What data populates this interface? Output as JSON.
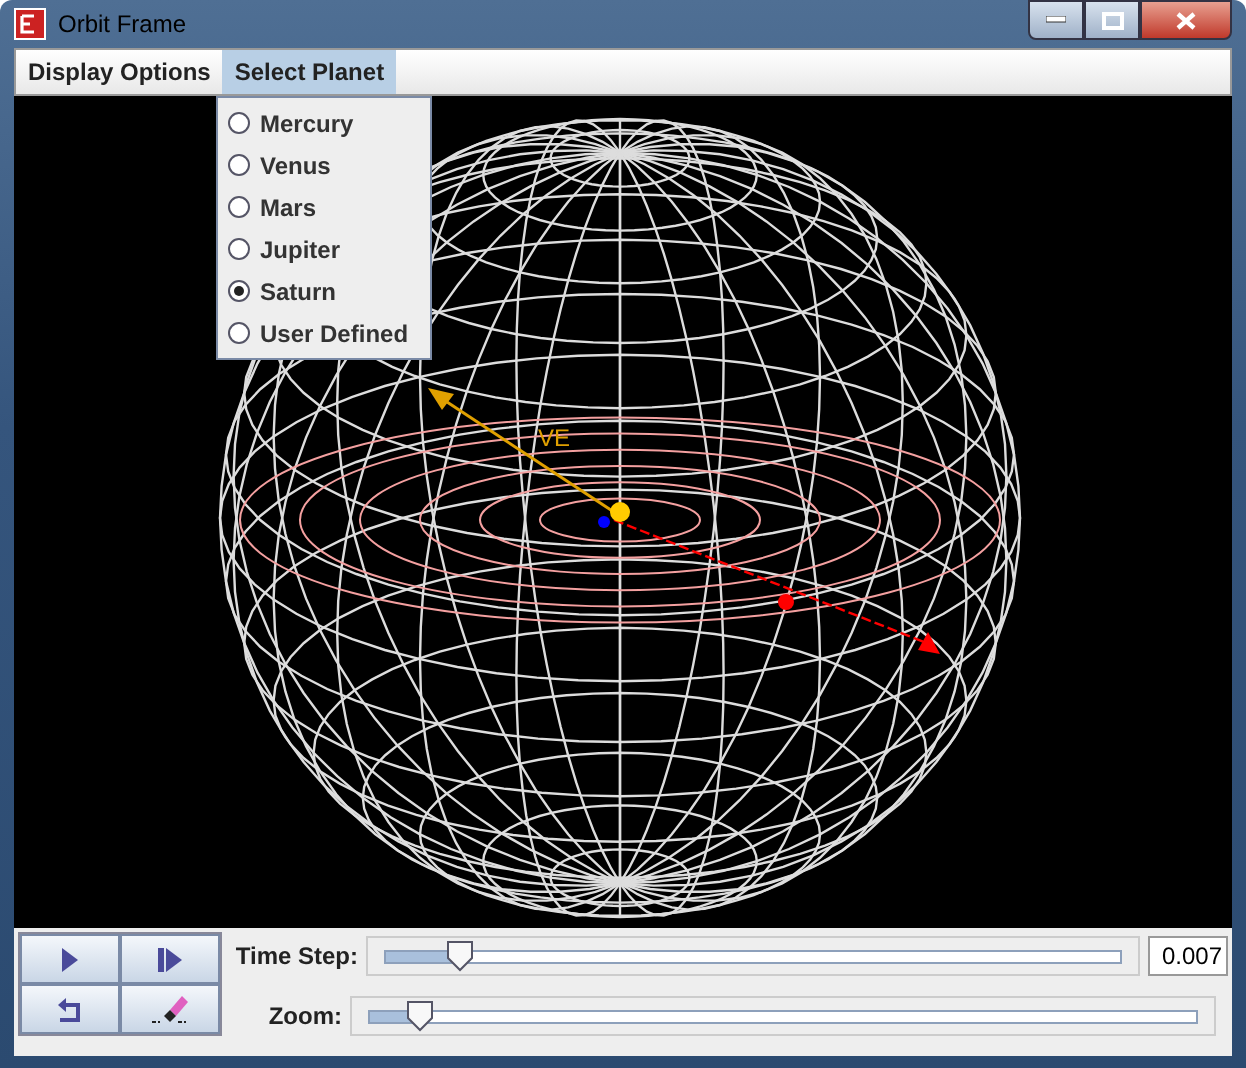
{
  "window": {
    "title": "Orbit Frame"
  },
  "menu": [
    {
      "label": "Display Options",
      "selected": false
    },
    {
      "label": "Select Planet",
      "selected": true
    }
  ],
  "planet_menu": [
    {
      "label": "Mercury",
      "selected": false
    },
    {
      "label": "Venus",
      "selected": false
    },
    {
      "label": "Mars",
      "selected": false
    },
    {
      "label": "Jupiter",
      "selected": false
    },
    {
      "label": "Saturn",
      "selected": true
    },
    {
      "label": "User Defined",
      "selected": false
    }
  ],
  "scene": {
    "vector_label": "VE"
  },
  "buttons": [
    {
      "kind": "play"
    },
    {
      "kind": "step"
    },
    {
      "kind": "reset"
    },
    {
      "kind": "clear"
    }
  ],
  "time_step": {
    "label": "Time Step:",
    "level": 0.1,
    "value": "0.007"
  },
  "zoom": {
    "label": "Zoom:",
    "level": 0.06
  }
}
